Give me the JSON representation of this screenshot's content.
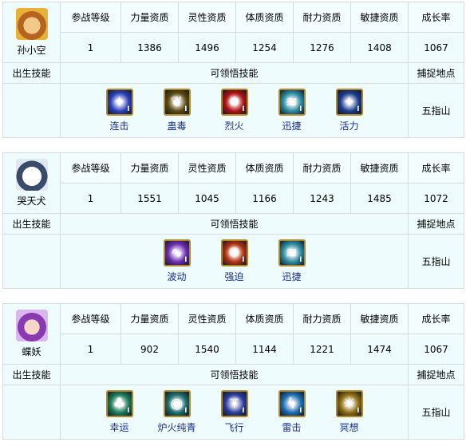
{
  "headers": [
    "参战等级",
    "力量资质",
    "灵性资质",
    "体质资质",
    "耐力资质",
    "敏捷资质",
    "成长率"
  ],
  "section_labels": {
    "birth": "出生技能",
    "learn": "可领悟技能",
    "catch": "捕捉地点"
  },
  "pets": [
    {
      "name": "孙小空",
      "avatar_icon": "monkey-king-avatar",
      "stats": [
        "1",
        "1386",
        "1496",
        "1254",
        "1276",
        "1408",
        "1067"
      ],
      "skills": [
        {
          "label": "连击",
          "icon": "combo-strike-icon",
          "color": "#2a3fb8"
        },
        {
          "label": "蛊毒",
          "icon": "poison-icon",
          "color": "#5a4a10"
        },
        {
          "label": "烈火",
          "icon": "fire-icon",
          "color": "#b01010"
        },
        {
          "label": "迅捷",
          "icon": "swift-icon",
          "color": "#2a8aa0"
        },
        {
          "label": "活力",
          "icon": "vitality-icon",
          "color": "#1a3a8a"
        }
      ],
      "location": "五指山"
    },
    {
      "name": "哭天犬",
      "avatar_icon": "dog-avatar",
      "stats": [
        "1",
        "1551",
        "1045",
        "1166",
        "1243",
        "1485",
        "1072"
      ],
      "skills": [
        {
          "label": "波动",
          "icon": "wave-icon",
          "color": "#6a2ab0"
        },
        {
          "label": "强迫",
          "icon": "compel-icon",
          "color": "#b03010"
        },
        {
          "label": "迅捷",
          "icon": "swift-icon",
          "color": "#2a8aa0"
        }
      ],
      "location": "五指山"
    },
    {
      "name": "蝶妖",
      "avatar_icon": "butterfly-fairy-avatar",
      "stats": [
        "1",
        "902",
        "1540",
        "1144",
        "1221",
        "1474",
        "1067"
      ],
      "skills": [
        {
          "label": "幸运",
          "icon": "luck-icon",
          "color": "#1a7a5a"
        },
        {
          "label": "炉火纯青",
          "icon": "mastery-icon",
          "color": "#1a6a6a"
        },
        {
          "label": "飞行",
          "icon": "flight-icon",
          "color": "#2a3a9a"
        },
        {
          "label": "雷击",
          "icon": "thunder-icon",
          "color": "#1a6ab0"
        },
        {
          "label": "冥想",
          "icon": "meditate-icon",
          "color": "#8a6a10"
        }
      ],
      "location": "五指山"
    }
  ]
}
